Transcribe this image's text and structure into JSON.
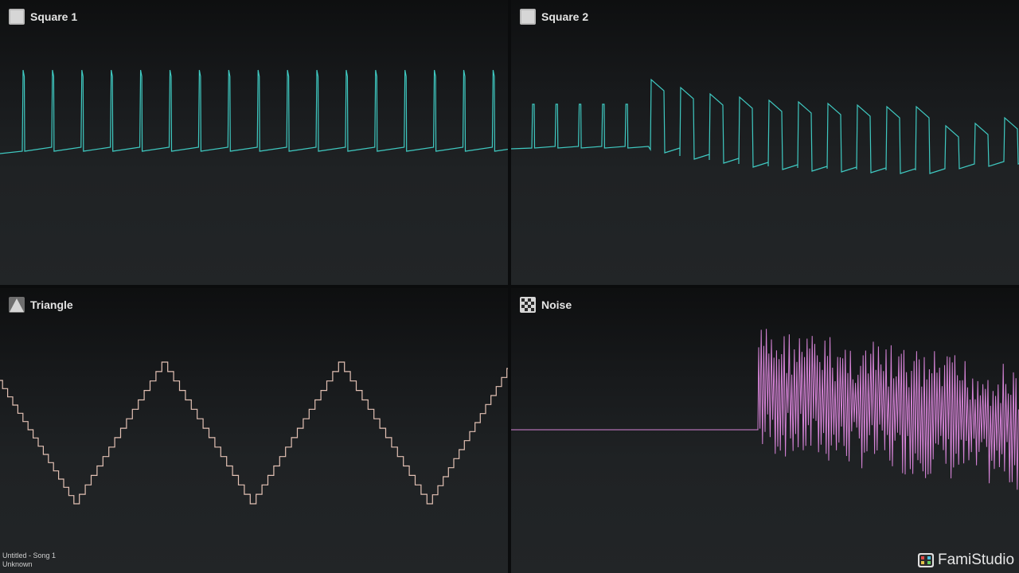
{
  "channels": [
    {
      "id": "sq1",
      "name": "Square 1",
      "icon": "square-channel-icon",
      "color": "#3fc9c1"
    },
    {
      "id": "sq2",
      "name": "Square 2",
      "icon": "square-channel-icon",
      "color": "#3fc9c1"
    },
    {
      "id": "tri",
      "name": "Triangle",
      "icon": "triangle-channel-icon",
      "color": "#e3c1b4"
    },
    {
      "id": "noise",
      "name": "Noise",
      "icon": "noise-channel-icon",
      "color": "#d784d8"
    }
  ],
  "song": {
    "title": "Untitled - Song 1",
    "author": "Unknown"
  },
  "brand": {
    "name": "FamiStudio"
  }
}
